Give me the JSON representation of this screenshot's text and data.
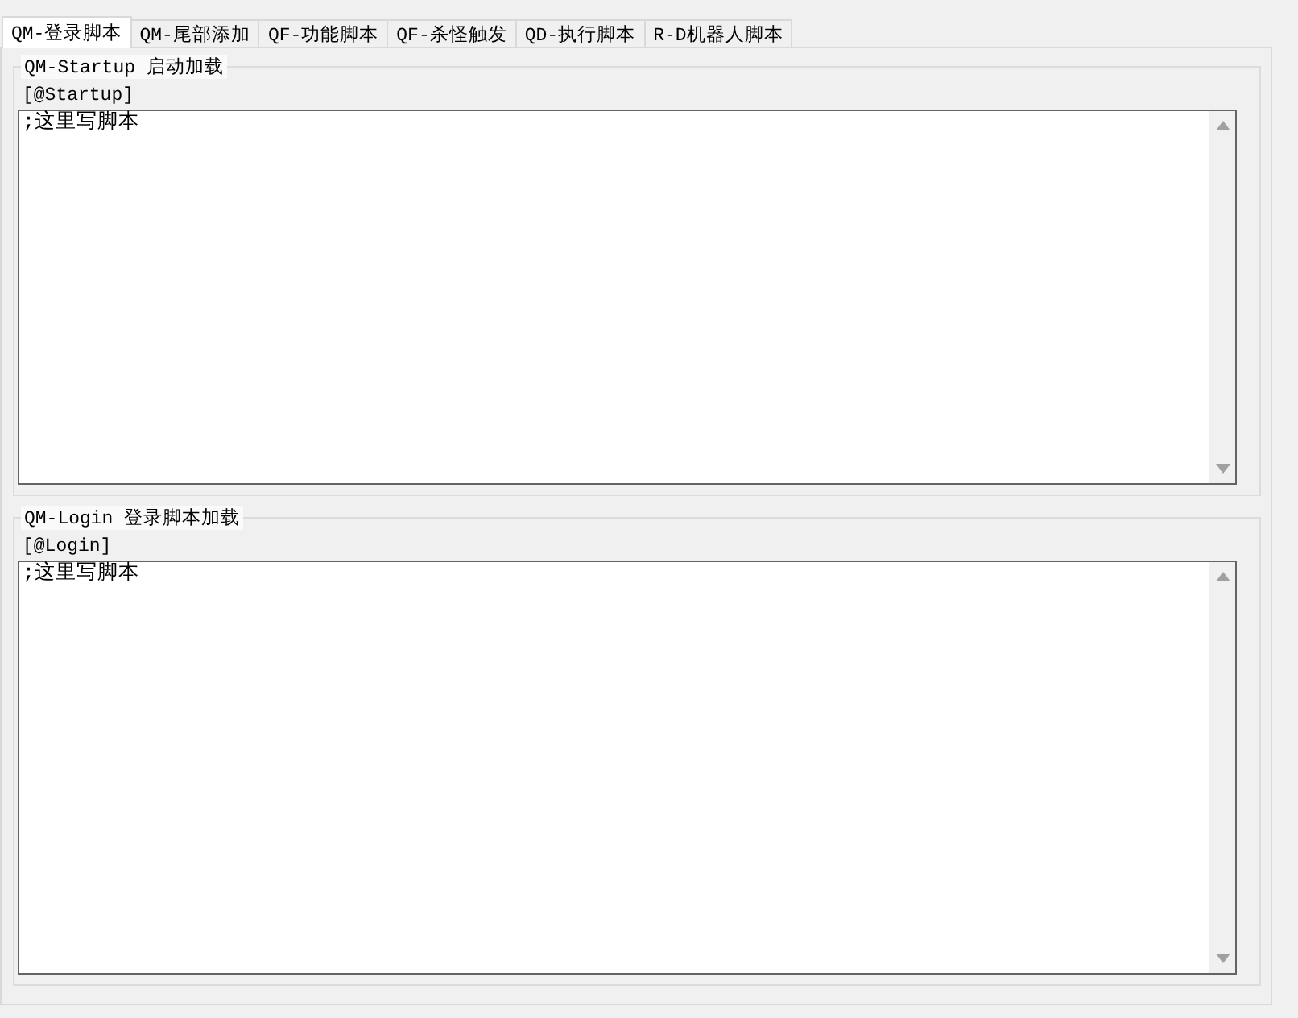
{
  "tabs": [
    {
      "label": "QM-登录脚本",
      "selected": true
    },
    {
      "label": "QM-尾部添加",
      "selected": false
    },
    {
      "label": "QF-功能脚本",
      "selected": false
    },
    {
      "label": "QF-杀怪触发",
      "selected": false
    },
    {
      "label": "QD-执行脚本",
      "selected": false
    },
    {
      "label": "R-D机器人脚本",
      "selected": false
    }
  ],
  "groups": [
    {
      "title": "QM-Startup 启动加载",
      "label": "[@Startup]",
      "value": ";这里写脚本"
    },
    {
      "title": "QM-Login 登录脚本加载",
      "label": "[@Login]",
      "value": ";这里写脚本"
    }
  ]
}
